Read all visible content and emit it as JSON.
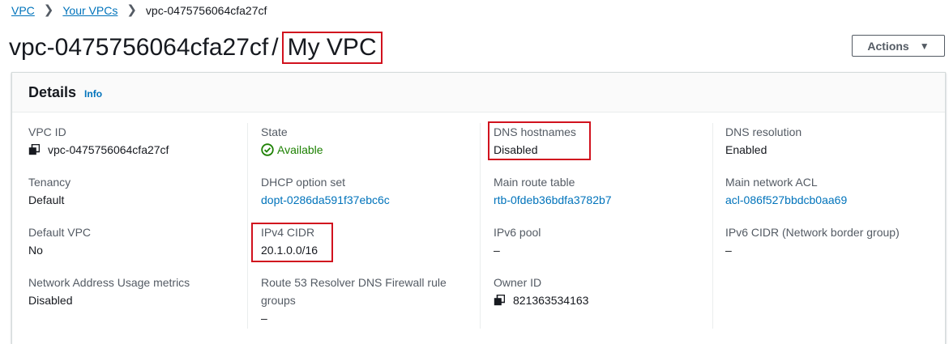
{
  "breadcrumb": {
    "items": [
      "VPC",
      "Your VPCs"
    ],
    "current": "vpc-0475756064cfa27cf"
  },
  "title": {
    "id": "vpc-0475756064cfa27cf",
    "separator": "/",
    "name": "My VPC"
  },
  "actions": {
    "label": "Actions",
    "icon": "caret-down-icon"
  },
  "details": {
    "heading": "Details",
    "info_link": "Info",
    "vpc_id": {
      "label": "VPC ID",
      "value": "vpc-0475756064cfa27cf"
    },
    "tenancy": {
      "label": "Tenancy",
      "value": "Default"
    },
    "default_vpc": {
      "label": "Default VPC",
      "value": "No"
    },
    "nau_metrics": {
      "label": "Network Address Usage metrics",
      "value": "Disabled"
    },
    "state": {
      "label": "State",
      "value": "Available"
    },
    "dhcp": {
      "label": "DHCP option set",
      "value": "dopt-0286da591f37ebc6c"
    },
    "ipv4_cidr": {
      "label": "IPv4 CIDR",
      "value": "20.1.0.0/16"
    },
    "route53": {
      "label_line1": "Route 53 Resolver DNS Firewall rule",
      "label_line2": "groups",
      "value": "–"
    },
    "dns_hostnames": {
      "label": "DNS hostnames",
      "value": "Disabled"
    },
    "main_route_table": {
      "label": "Main route table",
      "value": "rtb-0fdeb36bdfa3782b7"
    },
    "ipv6_pool": {
      "label": "IPv6 pool",
      "value": "–"
    },
    "owner_id": {
      "label": "Owner ID",
      "value": "821363534163"
    },
    "dns_resolution": {
      "label": "DNS resolution",
      "value": "Enabled"
    },
    "main_network_acl": {
      "label": "Main network ACL",
      "value": "acl-086f527bbdcb0aa69"
    },
    "ipv6_cidr": {
      "label": "IPv6 CIDR (Network border group)",
      "value": "–"
    }
  },
  "colors": {
    "link": "#0073bb",
    "success": "#1d8102",
    "highlight": "#d1121e",
    "label": "#545b64"
  }
}
